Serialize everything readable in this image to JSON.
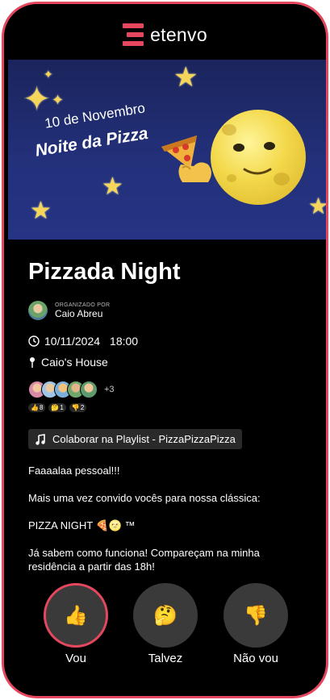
{
  "app": {
    "name": "etenvo"
  },
  "banner": {
    "date_text": "10 de Novembro",
    "title_text": "Noite da Pizza"
  },
  "event": {
    "title": "Pizzada Night",
    "organizer_label": "ORGANIZADO POR",
    "organizer_name": "Caio Abreu",
    "date": "10/11/2024",
    "time": "18:00",
    "location": "Caio's House",
    "attendees_more": "+3",
    "reactions": [
      {
        "emoji": "👍",
        "count": "8"
      },
      {
        "emoji": "🤔",
        "count": "1"
      },
      {
        "emoji": "👎",
        "count": "2"
      }
    ],
    "playlist_label": "Colaborar na Playlist - PizzaPizzaPizza",
    "description": [
      "Faaaalaa pessoal!!!",
      "Mais uma vez convido vocês para nossa clássica:",
      "PIZZA NIGHT 🍕🌝 ™",
      "Já sabem como funciona! Compareçam na minha residência a partir das 18h!"
    ]
  },
  "rsvp": {
    "yes": {
      "label": "Vou",
      "emoji": "👍"
    },
    "maybe": {
      "label": "Talvez",
      "emoji": "🤔"
    },
    "no": {
      "label": "Não vou",
      "emoji": "👎"
    }
  },
  "colors": {
    "accent": "#e5475e",
    "background": "#000000",
    "button": "#3a3a3a"
  }
}
